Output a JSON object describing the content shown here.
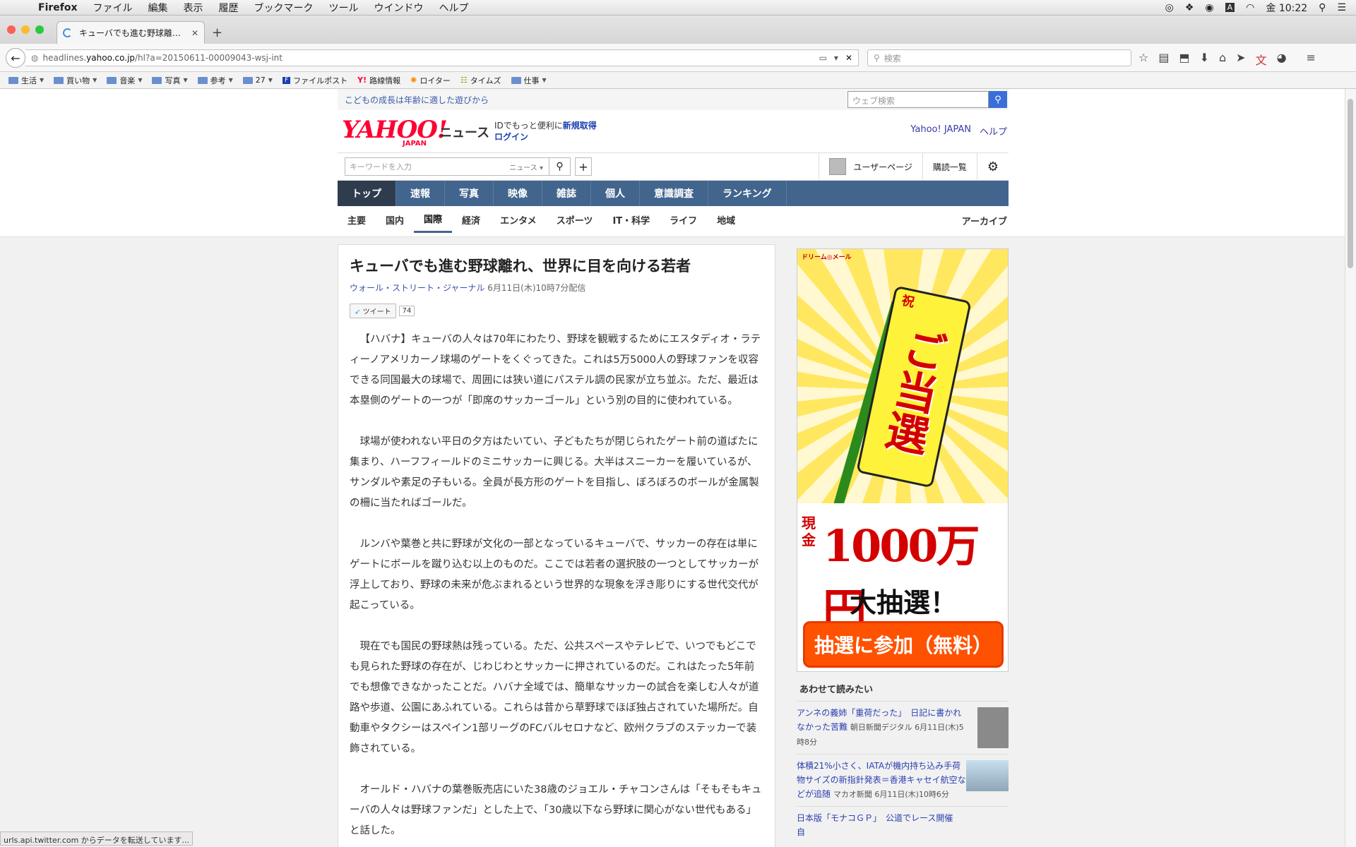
{
  "menubar": {
    "app": "Firefox",
    "items": [
      "ファイル",
      "編集",
      "表示",
      "履歴",
      "ブックマーク",
      "ツール",
      "ウインドウ",
      "ヘルプ"
    ],
    "clock": "金 10:22",
    "input_indicator": "A"
  },
  "tab": {
    "title": "キューバでも進む野球離れ、世界に目を..."
  },
  "url": {
    "prefix": "headlines.",
    "domain": "yahoo.co.jp",
    "path": "/hl?a=20150611-00009043-wsj-int"
  },
  "search": {
    "placeholder": "検索"
  },
  "bookmarks": [
    {
      "label": "生活",
      "folder": true,
      "menu": true
    },
    {
      "label": "買い物",
      "folder": true,
      "menu": true
    },
    {
      "label": "音楽",
      "folder": true,
      "menu": true
    },
    {
      "label": "写真",
      "folder": true,
      "menu": true
    },
    {
      "label": "参考",
      "folder": true,
      "menu": true
    },
    {
      "label": "27",
      "folder": true,
      "menu": true
    },
    {
      "label": "ファイルポスト",
      "folder": false,
      "menu": false
    },
    {
      "label": "路線情報",
      "folder": false,
      "menu": false
    },
    {
      "label": "ロイター",
      "folder": false,
      "menu": false
    },
    {
      "label": "タイムズ",
      "folder": false,
      "menu": false
    },
    {
      "label": "仕事",
      "folder": true,
      "menu": true
    }
  ],
  "promo": {
    "text": "こどもの成長は年齢に適した遊びから",
    "web_search_placeholder": "ウェブ検索"
  },
  "header": {
    "logo": "YAHOO!",
    "logo_sub": "JAPAN",
    "section": "ニュース",
    "id_line": "IDでもっと便利に",
    "register": "新規取得",
    "login": "ログイン",
    "link1": "Yahoo! JAPAN",
    "link2": "ヘルプ"
  },
  "searchrow": {
    "placeholder": "キーワードを入力",
    "category": "ニュース",
    "user_page": "ユーザーページ",
    "subscriptions": "購読一覧"
  },
  "nav1": [
    "トップ",
    "速報",
    "写真",
    "映像",
    "雑誌",
    "個人",
    "意識調査",
    "ランキング"
  ],
  "nav2": [
    "主要",
    "国内",
    "国際",
    "経済",
    "エンタメ",
    "スポーツ",
    "IT・科学",
    "ライフ",
    "地域"
  ],
  "nav2_archive": "アーカイブ",
  "article": {
    "title": "キューバでも進む野球離れ、世界に目を向ける若者",
    "source": "ウォール・ストリート・ジャーナル",
    "date": "6月11日(木)10時7分配信",
    "tweet_label": "ツイート",
    "tweet_count": "74",
    "paragraphs": [
      "【ハバナ】キューバの人々は70年にわたり、野球を観戦するためにエスタディオ・ラティーノアメリカーノ球場のゲートをくぐってきた。これは5万5000人の野球ファンを収容できる同国最大の球場で、周囲には狭い道にパステル調の民家が立ち並ぶ。ただ、最近は本塁側のゲートの一つが「即席のサッカーゴール」という別の目的に使われている。",
      "球場が使われない平日の夕方はたいてい、子どもたちが閉じられたゲート前の道ばたに集まり、ハーフフィールドのミニサッカーに興じる。大半はスニーカーを履いているが、サンダルや素足の子もいる。全員が長方形のゲートを目指し、ぼろぼろのボールが金属製の柵に当たればゴールだ。",
      "ルンバや葉巻と共に野球が文化の一部となっているキューバで、サッカーの存在は単にゲートにボールを蹴り込む以上のものだ。ここでは若者の選択肢の一つとしてサッカーが浮上しており、野球の未来が危ぶまれるという世界的な現象を浮き彫りにする世代交代が起こっている。",
      "現在でも国民の野球熱は残っている。ただ、公共スペースやテレビで、いつでもどこでも見られた野球の存在が、じわじわとサッカーに押されているのだ。これはたった5年前でも想像できなかったことだ。ハバナ全域では、簡単なサッカーの試合を楽しむ人々が道路や歩道、公園にあふれている。これらは昔から草野球でほぼ独占されていた場所だ。自動車やタクシーはスペイン1部リーグのFCバルセロナなど、欧州クラブのステッカーで装飾されている。",
      "オールド・ハバナの葉巻販売店にいた38歳のジョエル・チャコンさんは「そもそもキューバの人々は野球ファンだ」とした上で、「30歳以下なら野球に関心がない世代もある」と話した。"
    ]
  },
  "ad": {
    "brand": "ドリーム◎メール",
    "iwai": "祝",
    "flag": "ご当選",
    "genkin": "現金",
    "amount": "1000万円",
    "lottery": "大抽選！",
    "cta": "抽選に参加（無料）"
  },
  "related": {
    "heading": "あわせて読みたい",
    "items": [
      {
        "title": "アンネの義姉「重荷だった」　日記に書かれなかった苦難",
        "source": "朝日新聞デジタル 6月11日(木)5時8分"
      },
      {
        "title": "体積21%小さく、IATAが機内持ち込み手荷物サイズの新指針発表＝香港キャセイ航空などが追随",
        "source": "マカオ新聞 6月11日(木)10時6分"
      },
      {
        "title": "日本版「モナコＧＰ」　公道でレース開催　自",
        "source": ""
      }
    ]
  },
  "status": "urls.api.twitter.com からデータを転送しています..."
}
